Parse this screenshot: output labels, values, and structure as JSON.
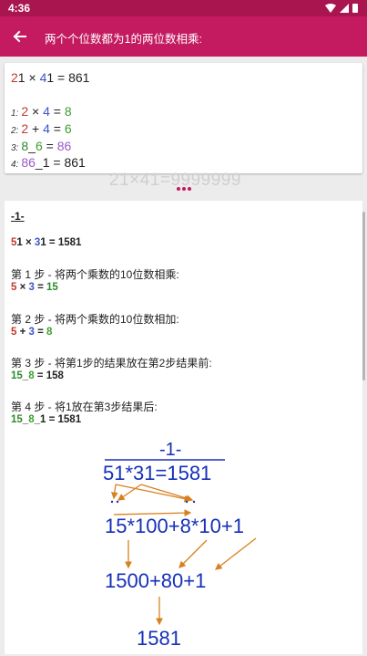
{
  "status_bar": {
    "time": "4:36"
  },
  "app_bar": {
    "title": "两个个位数都为1的两位数相乘:"
  },
  "summary": {
    "problem": {
      "a1": "2",
      "a2": "1",
      "op": " × ",
      "b1": "4",
      "b2": "1",
      "eq": " = 861"
    },
    "rows": [
      {
        "idx": "1:",
        "p1": "2",
        "p2": " × ",
        "p3": "4",
        "p4": " = ",
        "p5": "8"
      },
      {
        "idx": "2:",
        "p1": "2",
        "p2": " + ",
        "p3": "4",
        "p4": " = ",
        "p5": "6"
      },
      {
        "idx": "3:",
        "p1": "8",
        "p2": "_",
        "p3": "6",
        "p4": " = ",
        "p5": "86"
      },
      {
        "idx": "4:",
        "p1": "86",
        "p2": "_1",
        "p3": " = 861"
      }
    ]
  },
  "ghost_text": "21×41=9999999",
  "detail": {
    "section_title": "-1-",
    "equation": {
      "a1": "5",
      "a2": "1 × ",
      "b1": "3",
      "b2": "1 = 1581"
    },
    "steps": [
      {
        "label": "第 1 步 - 将两个乘数的10位数相乘:",
        "e1": "5",
        "e2": " × ",
        "e3": "3",
        "e4": " = ",
        "e5": "15"
      },
      {
        "label": "第 2 步 - 将两个乘数的10位数相加:",
        "e1": "5",
        "e2": " + ",
        "e3": "3",
        "e4": " = ",
        "e5": "8"
      },
      {
        "label": "第 3 步 - 将第1步的结果放在第2步结果前:",
        "e1": "15",
        "e2": "_",
        "e3": "8",
        "e4": " = 158"
      },
      {
        "label": "第 4 步 - 将1放在第3步结果后:",
        "e1": "15",
        "e2": "_",
        "e3": "8",
        "e4": "_1 = 1581"
      }
    ]
  },
  "diagram": {
    "title": "-1-",
    "line1": "51*31=1581",
    "line2": "15*100+8*10+1",
    "line3": "1500+80+1",
    "line4": "1581"
  },
  "colors": {
    "status_bar": "#a8154f",
    "app_bar": "#c31a60",
    "red": "#c0392b",
    "blue": "#3a55c7",
    "green": "#2d8a2d",
    "purple": "#9b59c6",
    "diagram_text": "#1630b8",
    "arrow": "#d9801e"
  }
}
